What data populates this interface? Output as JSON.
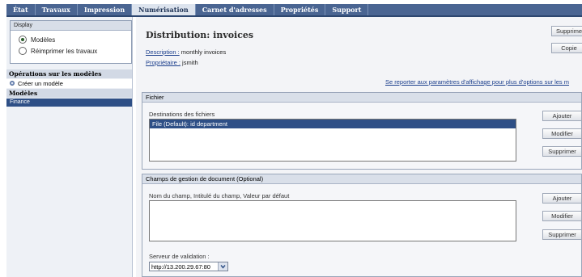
{
  "nav": {
    "tabs": [
      {
        "label": "État"
      },
      {
        "label": "Travaux"
      },
      {
        "label": "Impression"
      },
      {
        "label": "Numérisation"
      },
      {
        "label": "Carnet d'adresses"
      },
      {
        "label": "Propriétés"
      },
      {
        "label": "Support"
      }
    ],
    "active_tab": "Numérisation"
  },
  "sidebar": {
    "display_head": "Display",
    "radio_templates": "Modèles",
    "radio_reprint": "Réimprimer les travaux",
    "ops_head": "Opérations sur les modèles",
    "create_template": "Créer un modèle",
    "models_head": "Modèles",
    "model_finance": "Finance"
  },
  "main": {
    "title": "Distribution: invoices",
    "description_label": "Description :",
    "description_value": "monthly invoices",
    "owner_label": "Propriétaire :",
    "owner_value": "jsmith",
    "delete_btn": "Supprime",
    "copy_btn": "Copie",
    "settings_link": "Se reporter aux paramètres d'affichage pour plus d'options sur les m"
  },
  "file_section": {
    "head": "Fichier",
    "dest_label": "Destinations des fichiers",
    "dest_item": "File (Default): id department",
    "add_btn": "Ajouter",
    "modify_btn": "Modifier",
    "delete_btn": "Supprimer"
  },
  "doc_section": {
    "head": "Champs de gestion de document (Optional)",
    "fields_label": "Nom du champ, Intitulé du champ, Valeur par défaut",
    "add_btn": "Ajouter",
    "modify_btn": "Modifier",
    "delete_btn": "Supprimer",
    "validation_label": "Serveur de validation :",
    "validation_value": "http://13.200.29.67:80"
  }
}
